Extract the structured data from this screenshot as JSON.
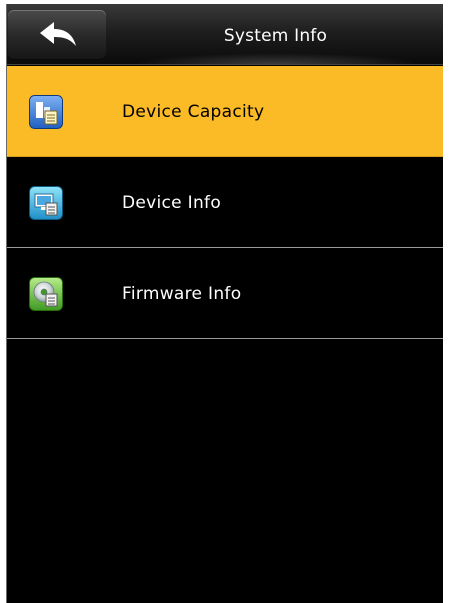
{
  "header": {
    "title": "System Info",
    "back_icon": "back-arrow-icon"
  },
  "menu": {
    "items": [
      {
        "label": "Device Capacity",
        "icon": "capacity-icon",
        "selected": true
      },
      {
        "label": "Device Info",
        "icon": "device-info-icon",
        "selected": false
      },
      {
        "label": "Firmware Info",
        "icon": "firmware-disc-icon",
        "selected": false
      }
    ]
  },
  "colors": {
    "selected_background": "#fbbb26",
    "background": "#000000",
    "text": "#ffffff",
    "divider": "#9a9a9a"
  }
}
